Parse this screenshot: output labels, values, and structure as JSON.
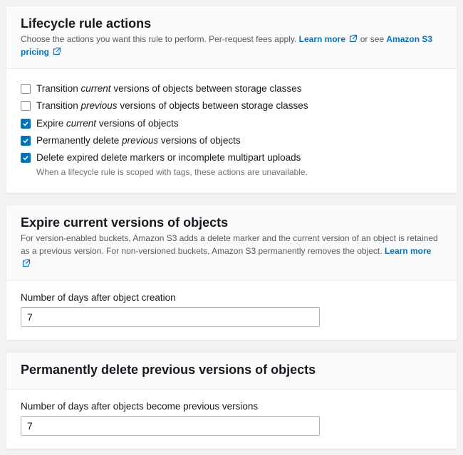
{
  "actions_panel": {
    "title": "Lifecycle rule actions",
    "subtitle_prefix": "Choose the actions you want this rule to perform. Per-request fees apply. ",
    "learn_more": "Learn more",
    "or_see": " or see ",
    "pricing_link": "Amazon S3 pricing",
    "items": [
      {
        "pre": "Transition ",
        "em": "current",
        "post": " versions of objects between storage classes",
        "checked": false,
        "hint": ""
      },
      {
        "pre": "Transition ",
        "em": "previous",
        "post": " versions of objects between storage classes",
        "checked": false,
        "hint": ""
      },
      {
        "pre": "Expire ",
        "em": "current",
        "post": " versions of objects",
        "checked": true,
        "hint": ""
      },
      {
        "pre": "Permanently delete ",
        "em": "previous",
        "post": " versions of objects",
        "checked": true,
        "hint": ""
      },
      {
        "pre": "Delete expired delete markers or incomplete multipart uploads",
        "em": "",
        "post": "",
        "checked": true,
        "hint": "When a lifecycle rule is scoped with tags, these actions are unavailable."
      }
    ]
  },
  "expire_panel": {
    "title": "Expire current versions of objects",
    "subtitle_prefix": "For version-enabled buckets, Amazon S3 adds a delete marker and the current version of an object is retained as a previous version. For non-versioned buckets, Amazon S3 permanently removes the object. ",
    "learn_more": "Learn more",
    "field_label": "Number of days after object creation",
    "value": "7"
  },
  "delete_panel": {
    "title": "Permanently delete previous versions of objects",
    "field_label": "Number of days after objects become previous versions",
    "value": "7"
  }
}
